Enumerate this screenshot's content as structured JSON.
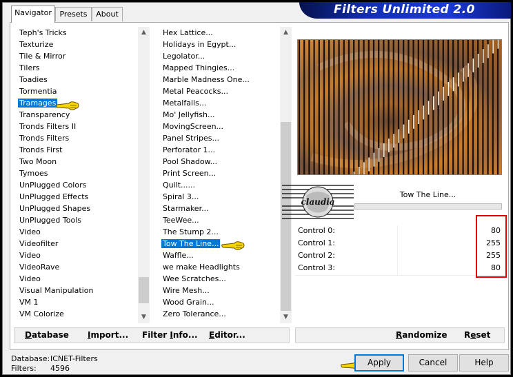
{
  "window": {
    "title": "Filters Unlimited 2.0"
  },
  "tabs": [
    {
      "label": "Navigator"
    },
    {
      "label": "Presets"
    },
    {
      "label": "About"
    }
  ],
  "categories": {
    "items": [
      "Teph's Tricks",
      "Texturize",
      "Tile & Mirror",
      "Tilers",
      "Toadies",
      "Tormentia",
      "Tramages",
      "Transparency",
      "Tronds Filters II",
      "Tronds Filters",
      "Tronds First",
      "Two Moon",
      "Tymoes",
      "UnPlugged Colors",
      "UnPlugged Effects",
      "UnPlugged Shapes",
      "UnPlugged Tools",
      "Video",
      "Videofilter",
      "Video",
      "VideoRave",
      "Video",
      "Visual Manipulation",
      "VM 1",
      "VM Colorize"
    ],
    "selected": "Tramages"
  },
  "filters": {
    "items": [
      "Hex Lattice...",
      "Holidays in Egypt...",
      "Legolator...",
      "Mapped Thingies...",
      "Marble Madness One...",
      "Metal Peacocks...",
      "Metalfalls...",
      "Mo' Jellyfish...",
      "MovingScreen...",
      "Panel Stripes...",
      "Perforator 1...",
      "Pool Shadow...",
      "Print Screen...",
      "Quilt......",
      "Spiral 3...",
      "Starmaker...",
      "TeeWee...",
      "The Stump 2...",
      "Tow The Line...",
      "Waffle...",
      "we make Headlights",
      "Wee Scratches...",
      "Wire Mesh...",
      "Wood Grain...",
      "Zero Tolerance..."
    ],
    "selected": "Tow The Line..."
  },
  "preview": {
    "filter_name": "Tow The Line...",
    "watermark": "claudia"
  },
  "controls": [
    {
      "label": "Control 0:",
      "value": "80"
    },
    {
      "label": "Control 1:",
      "value": "255"
    },
    {
      "label": "Control 2:",
      "value": "255"
    },
    {
      "label": "Control 3:",
      "value": "80"
    }
  ],
  "left_bar": {
    "database": {
      "pre": "",
      "key": "D",
      "post": "atabase"
    },
    "import": {
      "pre": "",
      "key": "I",
      "post": "mport..."
    },
    "filter_info": {
      "pre": "Filter ",
      "key": "I",
      "post": "nfo..."
    },
    "editor": {
      "pre": "",
      "key": "E",
      "post": "ditor..."
    }
  },
  "right_bar": {
    "randomize": {
      "pre": "",
      "key": "R",
      "post": "andomize"
    },
    "reset": {
      "pre": "R",
      "key": "e",
      "post": "set"
    }
  },
  "buttons": {
    "apply": "Apply",
    "cancel": "Cancel",
    "help": "Help"
  },
  "status": {
    "database_label": "Database:",
    "database_value": "ICNET-Filters",
    "filters_label": "Filters:",
    "filters_value": "4596"
  },
  "colors": {
    "selection": "#0078d7",
    "highlight_box": "#e00000",
    "banner": "#1330b5"
  }
}
